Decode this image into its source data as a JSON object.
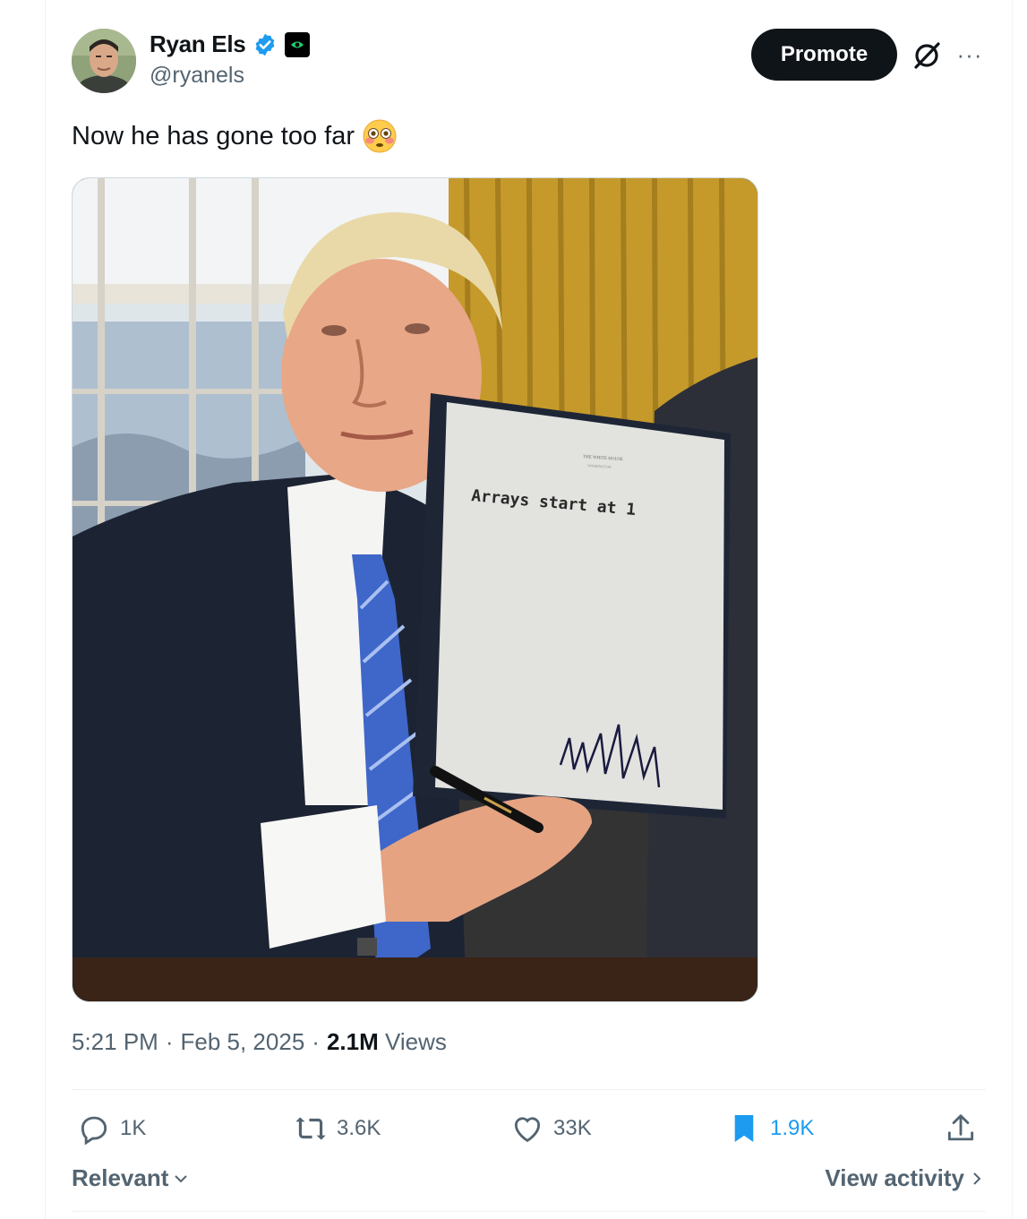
{
  "author": {
    "display_name": "Ryan Els",
    "handle": "@ryanels",
    "verified_icon": "verified-badge-icon",
    "affiliate_icon": "affiliate-badge-icon"
  },
  "header": {
    "promote_label": "Promote",
    "grok_icon": "grok-icon",
    "more_icon": "more-icon",
    "more_text": "···"
  },
  "tweet": {
    "text": "Now he has gone too far",
    "emoji": "flushed-face",
    "media": {
      "document_text": "Arrays start at 1",
      "letterhead": "THE WHITE HOUSE",
      "letterhead_sub": "WASHINGTON"
    },
    "time": "5:21 PM",
    "date": "Feb 5, 2025",
    "views_count": "2.1M",
    "views_label": "Views",
    "separator": "·"
  },
  "actions": {
    "replies": "1K",
    "reposts": "3.6K",
    "likes": "33K",
    "bookmarks": "1.9K"
  },
  "footer": {
    "sort_label": "Relevant",
    "view_activity_label": "View activity"
  },
  "colors": {
    "accent": "#1d9bf0",
    "text_primary": "#0f1419",
    "text_secondary": "#536471",
    "promote_bg": "#0f1419"
  }
}
